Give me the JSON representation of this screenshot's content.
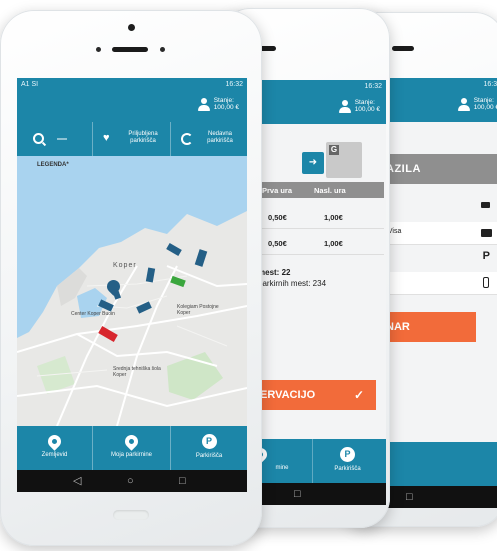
{
  "colors": {
    "primary": "#1c86a8",
    "accent": "#f26b3a",
    "navbar": "#111111"
  },
  "status": {
    "left": "A1 SI",
    "right": "16:32"
  },
  "status_right_mid": "16:32",
  "status_right_back": "16:32",
  "account": {
    "label": "Stanje:",
    "value": "100,00 €"
  },
  "search_bar": {
    "search_icon": "search-icon",
    "favorites_label": "Priljubljena parkirišča",
    "history_label": "Nedavna parkirišča"
  },
  "map": {
    "legend": "LEGENDA*",
    "city": "Koper",
    "poi1": "Center Koper Buoin",
    "poi2": "Kolegiam Postojne Koper",
    "poi3": "Srednja tehniška šola Koper"
  },
  "bottom_nav": [
    {
      "label": "Zemljevid",
      "icon": "map-pin-icon"
    },
    {
      "label": "Moja parkirnine",
      "icon": "person-pin-icon"
    },
    {
      "label": "Parkirišča",
      "icon": "parking-icon"
    }
  ],
  "nav_keys": {
    "back": "◁",
    "home": "○",
    "recent": "□"
  },
  "phone2": {
    "table_headers": [
      "Prva ura",
      "Nasl. ura"
    ],
    "rows": [
      [
        "0,50€",
        "1,00€"
      ],
      [
        "0,50€",
        "1,00€"
      ]
    ],
    "free_spots_label": "mest: 22",
    "total_spots_label": "parkirnih mest: 234",
    "reserve_button": "ERVACIJO",
    "nav_parkirisca": "Parkirišča",
    "nav_partial": "mine"
  },
  "phone3": {
    "section_title": "AZILA",
    "payment_label": "/ Visa",
    "pay_button": "NAR"
  }
}
